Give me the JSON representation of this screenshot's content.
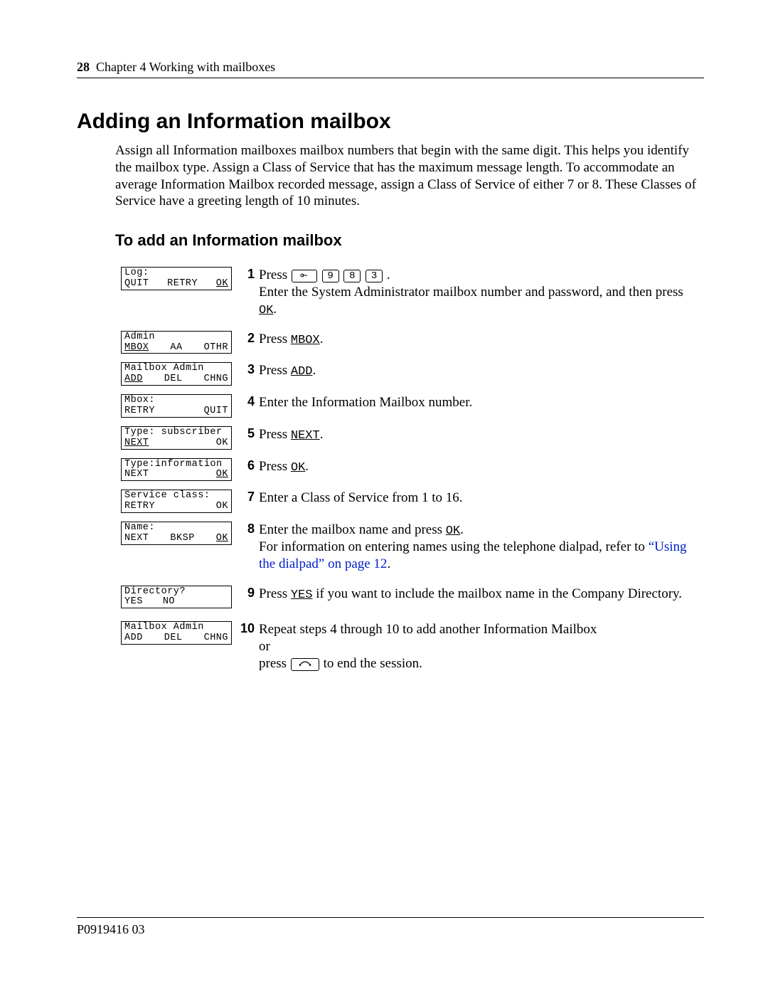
{
  "header": {
    "page": "28",
    "chapter": "Chapter 4  Working with mailboxes"
  },
  "title": "Adding an Information mailbox",
  "intro": "Assign all Information mailboxes mailbox numbers that begin with the same digit. This helps you identify the mailbox type. Assign a Class of Service that has the maximum message length. To accommodate an average Information Mailbox recorded message, assign a Class of Service of either 7 or 8. These Classes of Service have a greeting length of 10 minutes.",
  "subtitle": "To add an Information mailbox",
  "keys": {
    "d1": "9",
    "d2": "8",
    "d3": "3"
  },
  "steps": [
    {
      "num": "1",
      "lcd": {
        "top": "Log:",
        "b1": "QUIT",
        "b1u": false,
        "b2": "RETRY",
        "b2u": false,
        "b3": "OK",
        "b3u": true
      },
      "t_press": "Press ",
      "t_after": " .",
      "t_line2a": "Enter the System Administrator mailbox number and password, and then press ",
      "t_line2b": "OK",
      "t_line2c": "."
    },
    {
      "num": "2",
      "lcd": {
        "top": "Admin",
        "b1": "MBOX",
        "b1u": true,
        "b2": "AA",
        "b2u": false,
        "b3": "OTHR",
        "b3u": false
      },
      "t_a": "Press ",
      "t_b": "MBOX",
      "t_c": "."
    },
    {
      "num": "3",
      "lcd": {
        "top": "Mailbox Admin",
        "b1": "ADD",
        "b1u": true,
        "b2": "DEL",
        "b2u": false,
        "b3": "CHNG",
        "b3u": false
      },
      "t_a": "Press ",
      "t_b": "ADD",
      "t_c": "."
    },
    {
      "num": "4",
      "lcd": {
        "top": "Mbox:",
        "b1": "RETRY",
        "b1u": false,
        "b2": "",
        "b2u": false,
        "b3": "QUIT",
        "b3u": false
      },
      "t": "Enter the Information Mailbox number."
    },
    {
      "num": "5",
      "lcd": {
        "top": "Type: subscriber",
        "b1": "NEXT",
        "b1u": true,
        "b2": "",
        "b2u": false,
        "b3": "OK",
        "b3u": false
      },
      "t_a": "Press ",
      "t_b": "NEXT",
      "t_c": "."
    },
    {
      "num": "6",
      "lcd": {
        "top": "Type:information",
        "b1": "NEXT",
        "b1u": false,
        "b2": "",
        "b2u": false,
        "b3": "OK",
        "b3u": true
      },
      "t_a": "Press ",
      "t_b": "OK",
      "t_c": "."
    },
    {
      "num": "7",
      "lcd": {
        "top": "Service class:",
        "b1": "RETRY",
        "b1u": false,
        "b2": "",
        "b2u": false,
        "b3": "OK",
        "b3u": false
      },
      "t": "Enter a Class of Service from 1 to 16."
    },
    {
      "num": "8",
      "lcd": {
        "top": "Name:",
        "b1": "NEXT",
        "b1u": false,
        "b2": "BKSP",
        "b2u": false,
        "b3": "OK",
        "b3u": true
      },
      "t_a": "Enter the mailbox name and press ",
      "t_b": "OK",
      "t_c": ".",
      "t_2a": "For information on entering names using the telephone dialpad, refer to ",
      "xref": "“Using the dialpad” on page 12",
      "t_2c": "."
    },
    {
      "num": "9",
      "lcd": {
        "top": "Directory?",
        "b1": "YES",
        "b1u": false,
        "b2": "NO",
        "b2u": false,
        "b3": "",
        "b3u": false
      },
      "t_a": "Press ",
      "t_b": "YES",
      "t_c": " if you want to include the mailbox name in the Company Directory."
    },
    {
      "num": "10",
      "lcd": {
        "top": "Mailbox Admin",
        "b1": "ADD",
        "b1u": false,
        "b2": "DEL",
        "b2u": false,
        "b3": "CHNG",
        "b3u": false
      },
      "t_line1": "Repeat steps 4 through 10 to add another Information Mailbox",
      "t_or": "or",
      "t_press": "press ",
      "t_end": " to end the session."
    }
  ],
  "footer": "P0919416 03"
}
